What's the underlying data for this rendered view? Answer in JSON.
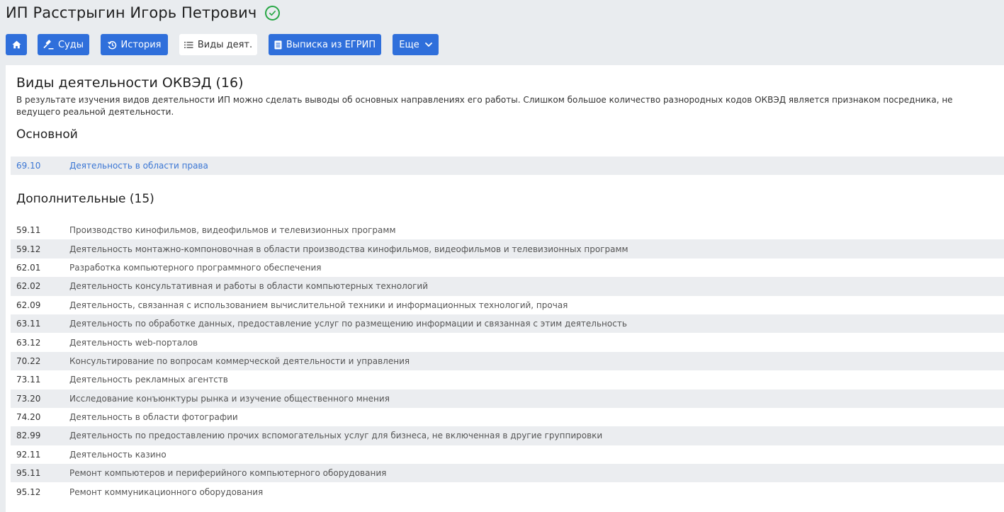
{
  "header": {
    "title": "ИП Расстрыгин Игорь Петрович",
    "verified_icon": "check-circle-icon"
  },
  "toolbar": {
    "home_icon": "home-icon",
    "courts_label": "Суды",
    "history_label": "История",
    "activities_label": "Виды деят.",
    "extract_label": "Выписка из ЕГРИП",
    "more_label": "Еще"
  },
  "section": {
    "title": "Виды деятельности ОКВЭД (16)",
    "description": "В результате изучения видов деятельности ИП можно сделать выводы об основных направлениях его работы. Слишком большое количество разнородных кодов ОКВЭД является признаком посредника, не ведущего реальной деятельности."
  },
  "main": {
    "heading": "Основной",
    "items": [
      {
        "code": "69.10",
        "name": "Деятельность в области права"
      }
    ]
  },
  "additional": {
    "heading": "Дополнительные (15)",
    "items": [
      {
        "code": "59.11",
        "name": "Производство кинофильмов, видеофильмов и телевизионных программ"
      },
      {
        "code": "59.12",
        "name": "Деятельность монтажно-компоновочная в области производства кинофильмов, видеофильмов и телевизионных программ"
      },
      {
        "code": "62.01",
        "name": "Разработка компьютерного программного обеспечения"
      },
      {
        "code": "62.02",
        "name": "Деятельность консультативная и работы в области компьютерных технологий"
      },
      {
        "code": "62.09",
        "name": "Деятельность, связанная с использованием вычислительной техники и информационных технологий, прочая"
      },
      {
        "code": "63.11",
        "name": "Деятельность по обработке данных, предоставление услуг по размещению информации и связанная с этим деятельность"
      },
      {
        "code": "63.12",
        "name": "Деятельность web-порталов"
      },
      {
        "code": "70.22",
        "name": "Консультирование по вопросам коммерческой деятельности и управления"
      },
      {
        "code": "73.11",
        "name": "Деятельность рекламных агентств"
      },
      {
        "code": "73.20",
        "name": "Исследование конъюнктуры рынка и изучение общественного мнения"
      },
      {
        "code": "74.20",
        "name": "Деятельность в области фотографии"
      },
      {
        "code": "82.99",
        "name": "Деятельность по предоставлению прочих вспомогательных услуг для бизнеса, не включенная в другие группировки"
      },
      {
        "code": "92.11",
        "name": "Деятельность казино"
      },
      {
        "code": "95.11",
        "name": "Ремонт компьютеров и периферийного компьютерного оборудования"
      },
      {
        "code": "95.12",
        "name": "Ремонт коммуникационного оборудования"
      }
    ]
  },
  "colors": {
    "accent": "#2f6fdb",
    "verified": "#28a745",
    "link": "#3a76d4",
    "row_alt": "#ebedf0",
    "background": "#e9ecef"
  }
}
